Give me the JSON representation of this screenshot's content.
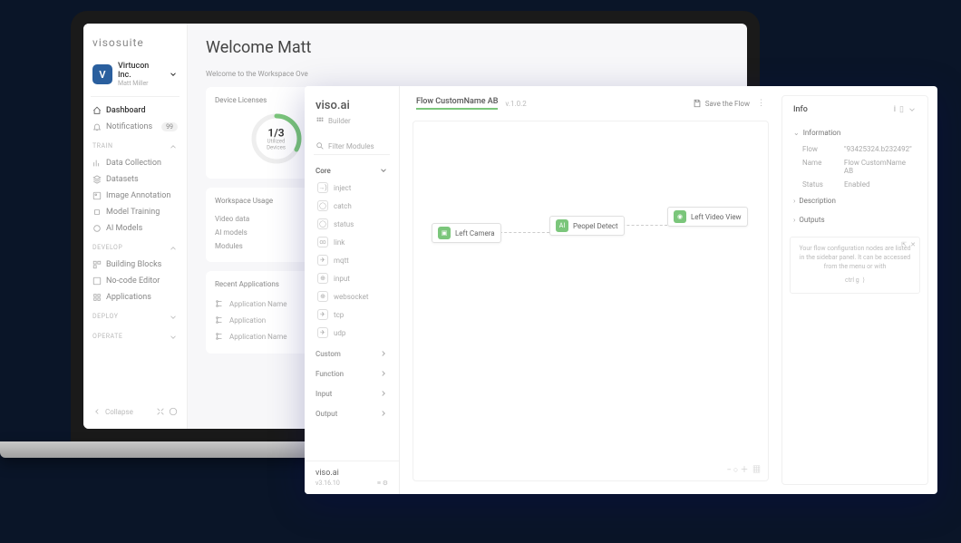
{
  "brand": "visosuite",
  "org": {
    "avatar": "V",
    "name": "Virtucon Inc.",
    "sub": "Matt Miller"
  },
  "nav": {
    "dashboard": "Dashboard",
    "notifications": "Notifications",
    "notifications_badge": "99"
  },
  "sections": {
    "train": "TRAIN",
    "train_items": [
      "Data Collection",
      "Datasets",
      "Image Annotation",
      "Model Training",
      "AI Models"
    ],
    "develop": "DEVELOP",
    "develop_items": [
      "Building Blocks",
      "No-code Editor",
      "Applications"
    ],
    "deploy": "DEPLOY",
    "operate": "OPERATE"
  },
  "collapse": "Collapse",
  "dash": {
    "title": "Welcome Matt",
    "sub": "Welcome to the Workspace Ove",
    "licenses_title": "Device Licenses",
    "licenses_value": "1/3",
    "licenses_label": "Utilized Devices",
    "usage_title": "Workspace Usage",
    "usage_items": [
      "Video data",
      "AI models",
      "Modules"
    ],
    "recent_title": "Recent Applications",
    "recent_items": [
      "Application Name",
      "Application",
      "Application Name"
    ]
  },
  "builder": {
    "brand": "viso.ai",
    "label": "Builder",
    "filter_placeholder": "Filter Modules",
    "sections": {
      "core": "Core",
      "custom": "Custom",
      "function": "Function",
      "input": "Input",
      "output": "Output"
    },
    "core_modules": [
      "inject",
      "catch",
      "status",
      "link",
      "mqtt",
      "input",
      "websocket",
      "tcp",
      "udp"
    ],
    "footer_brand": "viso.ai",
    "footer_version": "v3.16.10",
    "flow_name": "Flow CustomName AB",
    "flow_version": "v.1.0.2",
    "save": "Save the Flow",
    "nodes": {
      "left_camera": "Left Camera",
      "people_detect": "Peopel Detect",
      "left_video": "Left Video View"
    },
    "info": {
      "title": "Info",
      "information": "Information",
      "flow_k": "Flow",
      "flow_v": "\"93425324.b232492\"",
      "name_k": "Name",
      "name_v": "Flow CustomName AB",
      "status_k": "Status",
      "status_v": "Enabled",
      "description": "Description",
      "outputs": "Outputs",
      "tip": "Your flow configuration nodes are listed in the sidebar panel. It can be accessed from the menu or with",
      "tip_ctrl": "ctrl g"
    }
  }
}
